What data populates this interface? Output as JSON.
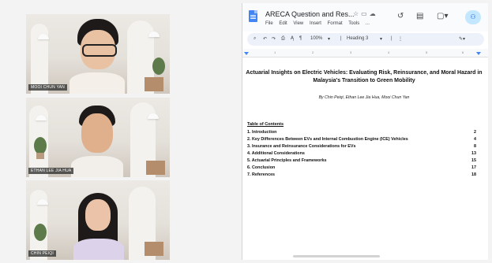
{
  "participants": [
    {
      "name": "MOOI CHUN YAN"
    },
    {
      "name": "ETHAN LEE JIA HUA"
    },
    {
      "name": "CHIN PEIQI"
    }
  ],
  "docs": {
    "title": "ARECA Question and Res...",
    "menu": [
      "File",
      "Edit",
      "View",
      "Insert",
      "Format",
      "Tools",
      "..."
    ],
    "toolbar": {
      "zoom": "100%",
      "style": "Heading 3"
    },
    "ruler_marks": [
      "1",
      "2",
      "3",
      "4",
      "5",
      "6"
    ],
    "heading": "Actuarial Insights on Electric Vehicles: Evaluating Risk, Reinsurance, and Moral Hazard in Malaysia's Transition to Green Mobility",
    "authors": "By Chin Peiqi, Ethan Lee Jia Hua, Mooi Chun Yan",
    "toc_title": "Table of Contents",
    "toc": [
      {
        "label": "1. Introduction",
        "page": "2"
      },
      {
        "label": "2. Key Differences Between EVs and Internal Combustion Engine (ICE) Vehicles",
        "page": "4"
      },
      {
        "label": "3. Insurance and Reinsurance Considerations for EVs",
        "page": "8"
      },
      {
        "label": "4. Additional Considerations",
        "page": "13"
      },
      {
        "label": "5. Actuarial Principles and Frameworks",
        "page": "15"
      },
      {
        "label": "6. Conclusion",
        "page": "17"
      },
      {
        "label": "7. References",
        "page": "18"
      }
    ]
  },
  "icons": [
    "star-icon",
    "folder-icon",
    "cloud-icon",
    "history-icon",
    "comment-icon",
    "meet-icon",
    "share-icon",
    "search-icon",
    "undo-icon",
    "redo-icon",
    "print-icon",
    "spellcheck-icon",
    "paint-format-icon",
    "edit-mode-icon"
  ]
}
